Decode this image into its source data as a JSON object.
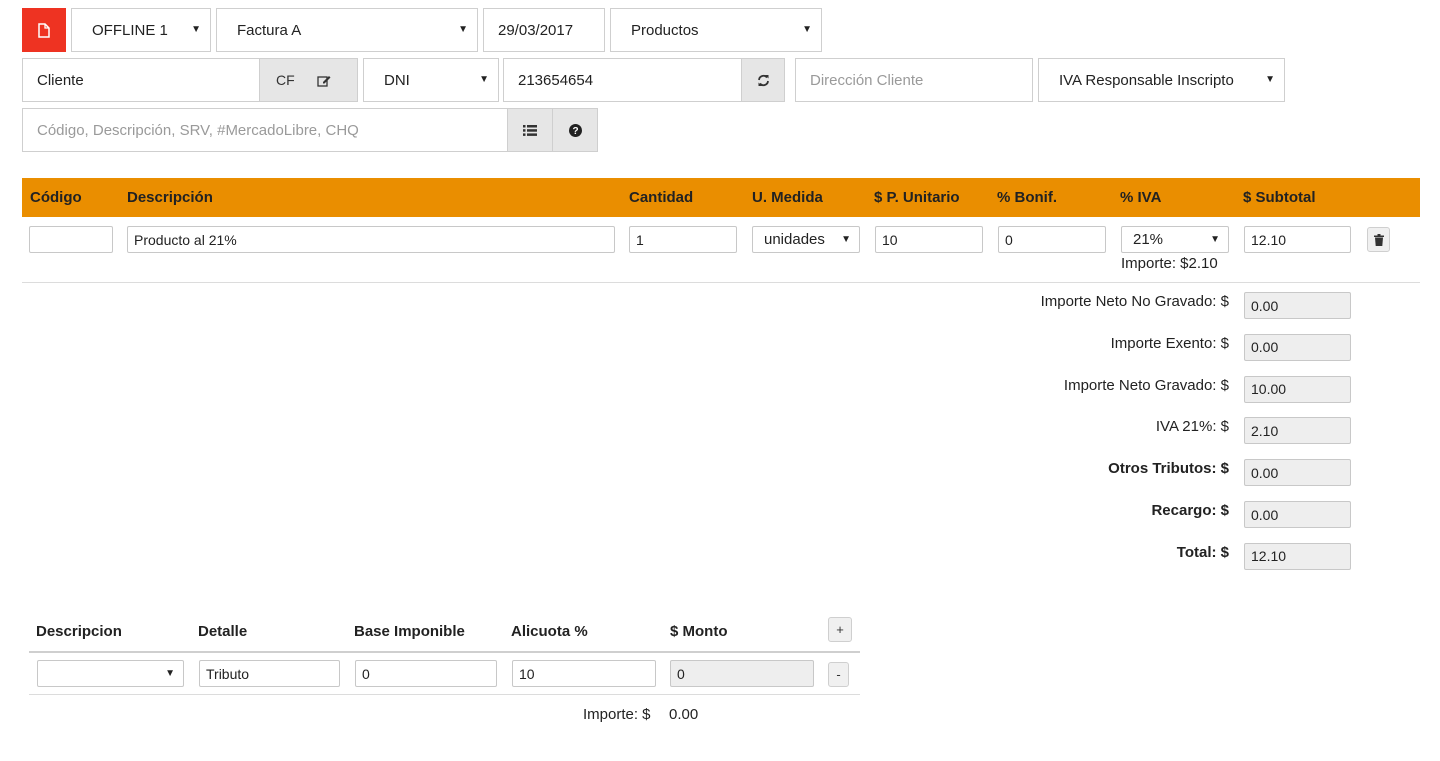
{
  "header": {
    "punto_venta": "OFFLINE 1",
    "tipo_comprobante": "Factura A",
    "fecha": "29/03/2017",
    "concepto": "Productos"
  },
  "cliente": {
    "nombre": "Cliente",
    "cf_label": "CF",
    "doc_tipo": "DNI",
    "doc_numero": "213654654",
    "direccion_placeholder": "Dirección Cliente",
    "condicion_iva": "IVA Responsable Inscripto"
  },
  "search": {
    "placeholder": "Código, Descripción, SRV, #MercadoLibre, CHQ"
  },
  "items_table": {
    "headers": [
      "Código",
      "Descripción",
      "Cantidad",
      "U. Medida",
      "$ P. Unitario",
      "% Bonif.",
      "% IVA",
      "$ Subtotal"
    ],
    "row": {
      "codigo": "",
      "descripcion": "Producto al 21%",
      "cantidad": "1",
      "unidad": "unidades",
      "precio": "10",
      "bonif": "0",
      "iva": "21%",
      "subtotal": "12.10",
      "importe_iva": "Importe: $2.10"
    }
  },
  "totals": [
    {
      "label": "Importe Neto No Gravado: $",
      "value": "0.00",
      "bold": false
    },
    {
      "label": "Importe Exento: $",
      "value": "0.00",
      "bold": false
    },
    {
      "label": "Importe Neto Gravado: $",
      "value": "10.00",
      "bold": false
    },
    {
      "label": "IVA 21%: $",
      "value": "2.10",
      "bold": false
    },
    {
      "label": "Otros Tributos: $",
      "value": "0.00",
      "bold": true
    },
    {
      "label": "Recargo: $",
      "value": "0.00",
      "bold": true
    },
    {
      "label": "Total: $",
      "value": "12.10",
      "bold": true
    }
  ],
  "tributos": {
    "headers": [
      "Descripcion",
      "Detalle",
      "Base Imponible",
      "Alicuota %",
      "$ Monto"
    ],
    "add_label": "+",
    "remove_label": "-",
    "row": {
      "descripcion": "",
      "detalle": "Tributo",
      "base": "0",
      "alicuota": "10",
      "monto": "0"
    },
    "importe_label": "Importe: $",
    "importe_value": "0.00"
  },
  "colors": {
    "accent": "#ea8e00",
    "danger": "#ee3322"
  }
}
